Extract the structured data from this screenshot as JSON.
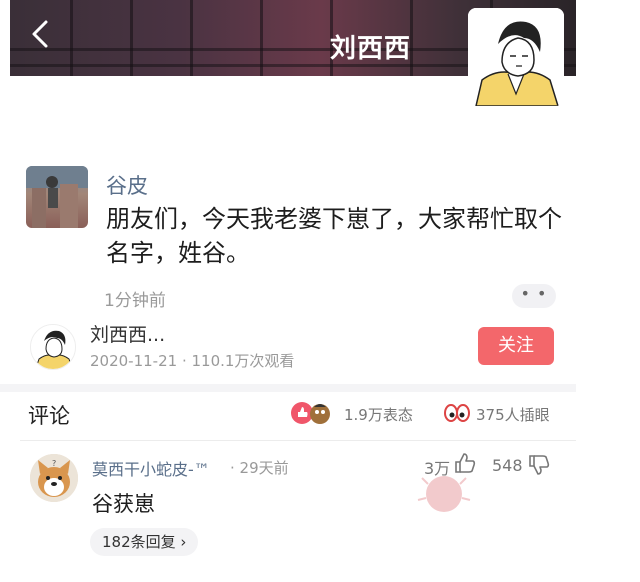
{
  "header": {
    "title": "刘西西",
    "back_icon": "chevron-left-icon"
  },
  "post": {
    "author": "谷皮",
    "text": "朋友们，今天我老婆下崽了，大家帮忙取个名字，姓谷。",
    "time": "1分钟前",
    "more": "• •"
  },
  "author_card": {
    "name": "刘西西...",
    "meta": "2020-11-21 · 110.1万次观看",
    "follow_label": "关注",
    "accent": "#f3676b"
  },
  "comments_bar": {
    "title": "评论",
    "reactions": "1.9万表态",
    "inserts": "375人插眼"
  },
  "comment": {
    "author": "莫西干小蛇皮-™",
    "time": "· 29天前",
    "likes": "3万",
    "dislikes": "548",
    "text": "谷获崽",
    "replies": "182条回复 ›"
  }
}
